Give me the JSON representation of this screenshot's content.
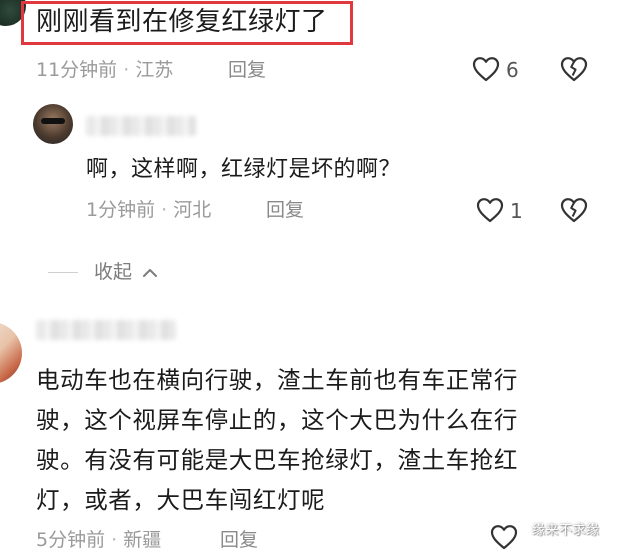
{
  "comments": [
    {
      "text": "刚刚看到在修复红绿灯了",
      "time": "11分钟前",
      "separator": "·",
      "location": "江苏",
      "reply_label": "回复",
      "like_count": "6"
    },
    {
      "text": "啊，这样啊，红绿灯是坏的啊？",
      "time": "1分钟前",
      "separator": "·",
      "location": "河北",
      "reply_label": "回复",
      "like_count": "1"
    },
    {
      "lines": [
        "电动车也在横向行驶，渣土车前也有车正常行",
        "驶，这个视屏车停止的，这个大巴为什么在行",
        "驶。有没有可能是大巴车抢绿灯，渣土车抢红",
        "灯，或者，大巴车闯红灯呢"
      ],
      "time": "5分钟前",
      "separator": "·",
      "location": "新疆",
      "reply_label": "回复"
    }
  ],
  "collapse_label": "收起",
  "watermark": "缘来不求缘",
  "icons": {
    "like": "heart-outline-icon",
    "dislike": "broken-heart-outline-icon",
    "collapse": "chevron-up-icon"
  },
  "colors": {
    "highlight": "#e0383e",
    "meta_text": "#9a9a9a",
    "body_text": "#1b1b1b"
  }
}
